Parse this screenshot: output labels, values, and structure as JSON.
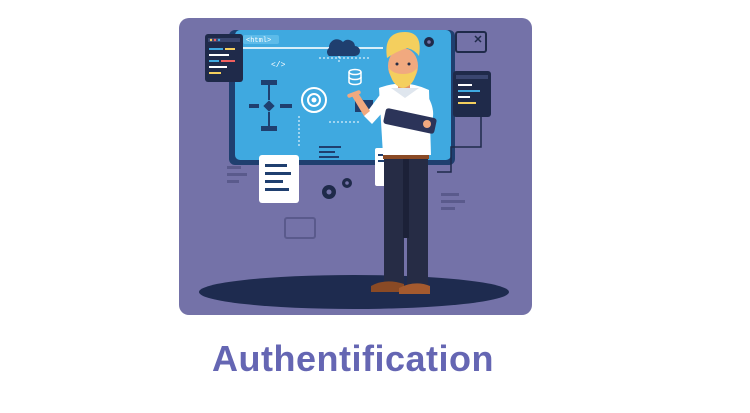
{
  "card": {
    "illustration": "developer-presenting-workflow-dashboard",
    "code_tag": "<html>",
    "code_symbol": "</>"
  },
  "title": "Authentification",
  "colors": {
    "title": "#6566b3",
    "card_bg": "#7472a8",
    "screen": "#3fa9e0",
    "screen_dark": "#1f3f6f",
    "floor_shadow": "#1e2b4f",
    "hair": "#f4cf5e",
    "skin": "#f1a97f",
    "shirt": "#ffffff",
    "pants": "#262c45",
    "shoes": "#8a4a25"
  }
}
